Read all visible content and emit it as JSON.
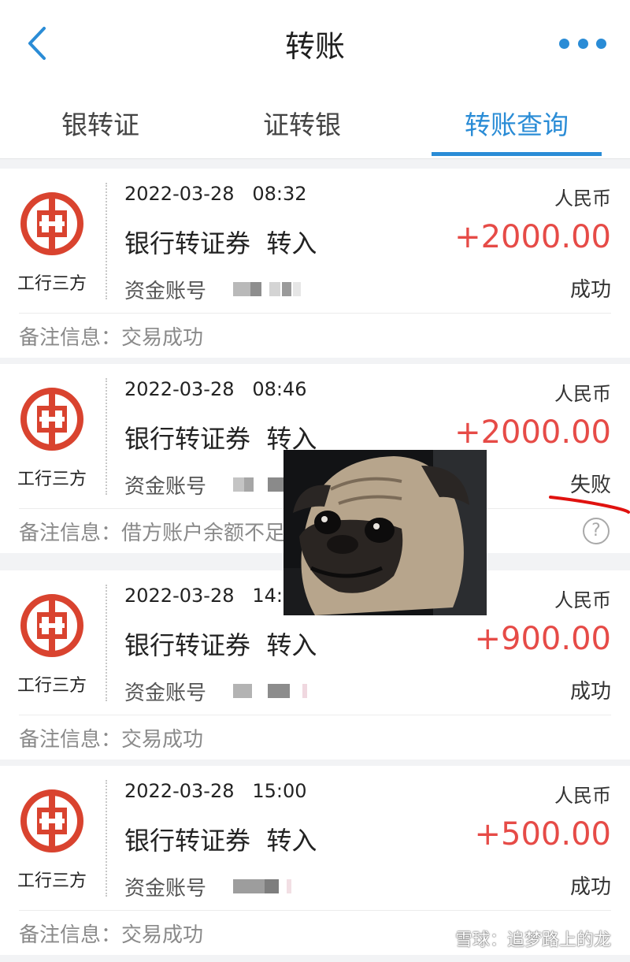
{
  "header": {
    "title": "转账",
    "back_icon": "chevron-left-icon",
    "more_icon": "more-dots-icon",
    "accent_color": "#2a8cd6"
  },
  "tabs": [
    {
      "label": "银转证",
      "active": false
    },
    {
      "label": "证转银",
      "active": false
    },
    {
      "label": "转账查询",
      "active": true
    }
  ],
  "records": [
    {
      "bank": "工行三方",
      "date": "2022-03-28",
      "time": "08:32",
      "currency": "人民币",
      "type": "银行转证券",
      "direction": "转入",
      "amount": "+2000.00",
      "account_label": "资金账号",
      "status": "成功",
      "remark_label": "备注信息：",
      "remark": "交易成功"
    },
    {
      "bank": "工行三方",
      "date": "2022-03-28",
      "time": "08:46",
      "currency": "人民币",
      "type": "银行转证券",
      "direction": "转入",
      "amount": "+2000.00",
      "account_label": "资金账号",
      "status": "失败",
      "remark_label": "备注信息：",
      "remark": "借方账户余额不足"
    },
    {
      "bank": "工行三方",
      "date": "2022-03-28",
      "time": "14:4",
      "currency": "人民币",
      "type": "银行转证券",
      "direction": "转入",
      "amount": "+900.00",
      "account_label": "资金账号",
      "status": "成功",
      "remark_label": "备注信息：",
      "remark": "交易成功"
    },
    {
      "bank": "工行三方",
      "date": "2022-03-28",
      "time": "15:00",
      "currency": "人民币",
      "type": "银行转证券",
      "direction": "转入",
      "amount": "+500.00",
      "account_label": "资金账号",
      "status": "成功",
      "remark_label": "备注信息：",
      "remark": "交易成功"
    }
  ],
  "colors": {
    "amount": "#e64b47",
    "bank_logo": "#d9432f"
  },
  "watermark": "雪球：追梦路上的龙"
}
